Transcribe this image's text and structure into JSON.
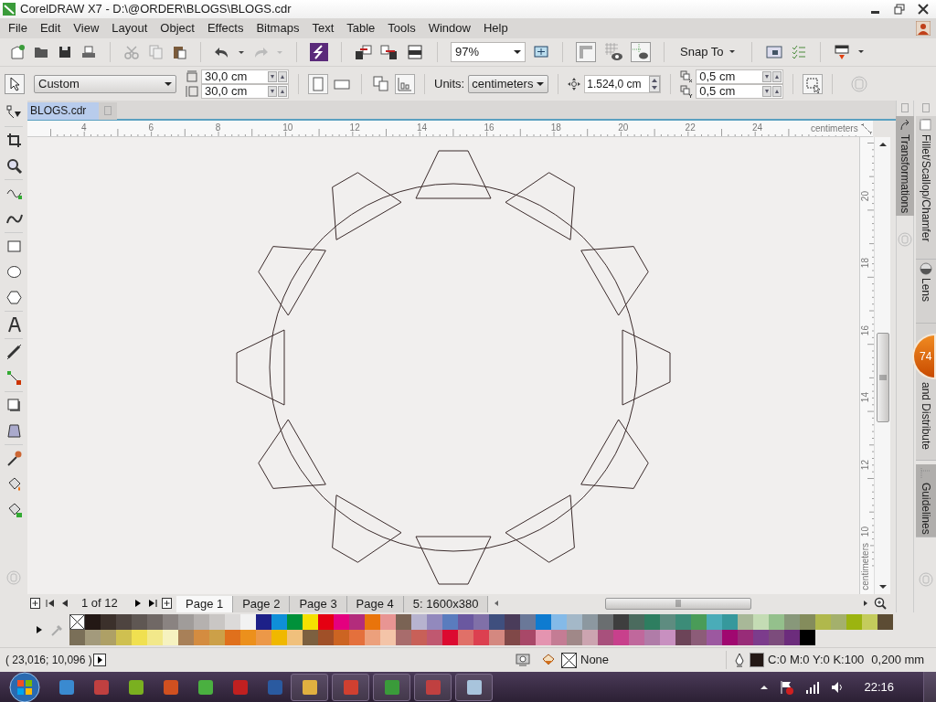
{
  "window": {
    "title": "CorelDRAW X7 - D:\\@ORDER\\BLOGS\\BLOGS.cdr"
  },
  "menu": [
    "File",
    "Edit",
    "View",
    "Layout",
    "Object",
    "Effects",
    "Bitmaps",
    "Text",
    "Table",
    "Tools",
    "Window",
    "Help"
  ],
  "toolbar": {
    "zoom": "97%",
    "snap_to": "Snap To"
  },
  "property_bar": {
    "page_size": "Custom",
    "width": "30,0 cm",
    "height": "30,0 cm",
    "units_label": "Units:",
    "units": "centimeters",
    "nudge": "1.524,0 cm",
    "dup_x": "0,5 cm",
    "dup_y": "0,5 cm"
  },
  "document_tab": {
    "title": "BLOGS.cdr"
  },
  "horizontal_ruler": {
    "ticks": [
      "4",
      "6",
      "8",
      "10",
      "12",
      "14",
      "16",
      "18",
      "20",
      "22",
      "24"
    ],
    "unit": "centimeters"
  },
  "vertical_ruler": {
    "ticks": [
      "20",
      "18",
      "16",
      "14",
      "12",
      "10"
    ],
    "unit": "centimeters"
  },
  "dockers": [
    {
      "label": "Transformations",
      "selected": true
    },
    {
      "label": "Fillet/Scallop/Chamfer",
      "selected": false
    },
    {
      "label": "Lens",
      "selected": false
    },
    {
      "label": "and Distribute",
      "selected": false
    },
    {
      "label": "Guidelines",
      "selected": true
    }
  ],
  "notification_badge": "74",
  "page_navigator": {
    "counter": "1 of 12",
    "pages": [
      {
        "label": "Page 1",
        "selected": true
      },
      {
        "label": "Page 2",
        "selected": false
      },
      {
        "label": "Page 3",
        "selected": false
      },
      {
        "label": "Page 4",
        "selected": false
      },
      {
        "label": "5: 1600x380",
        "selected": false
      }
    ]
  },
  "palette": {
    "rows": [
      [
        {
          "kind": "none"
        },
        {
          "kind": "swatch",
          "color": "#231815"
        },
        {
          "kind": "swatch",
          "color": "#3b302b"
        },
        {
          "kind": "swatch",
          "color": "#4e4440"
        },
        {
          "kind": "swatch",
          "color": "#5f5753"
        },
        {
          "kind": "swatch",
          "color": "#706865"
        },
        {
          "kind": "swatch",
          "color": "#8a8381"
        },
        {
          "kind": "swatch",
          "color": "#a09c9a"
        },
        {
          "kind": "swatch",
          "color": "#b5b1af"
        },
        {
          "kind": "swatch",
          "color": "#c9c6c4"
        },
        {
          "kind": "swatch",
          "color": "#dcdad9"
        },
        {
          "kind": "swatch",
          "color": "#f2f2f2"
        },
        {
          "kind": "swatch",
          "color": "#1d2088"
        },
        {
          "kind": "swatch",
          "color": "#0f8fd8"
        },
        {
          "kind": "swatch",
          "color": "#00913a"
        },
        {
          "kind": "swatch",
          "color": "#f5e100"
        },
        {
          "kind": "swatch",
          "color": "#e50012"
        },
        {
          "kind": "swatch",
          "color": "#e4007f"
        },
        {
          "kind": "swatch",
          "color": "#b32c7c"
        },
        {
          "kind": "swatch",
          "color": "#e9740b"
        },
        {
          "kind": "swatch",
          "color": "#e89593"
        },
        {
          "kind": "swatch",
          "color": "#7a6354"
        },
        {
          "kind": "swatch",
          "color": "#b7b3cf"
        },
        {
          "kind": "swatch",
          "color": "#9289bd"
        },
        {
          "kind": "swatch",
          "color": "#5a7cbe"
        },
        {
          "kind": "swatch",
          "color": "#6a58a0"
        },
        {
          "kind": "swatch",
          "color": "#8070a8"
        },
        {
          "kind": "swatch",
          "color": "#3f4f7e"
        },
        {
          "kind": "swatch",
          "color": "#4a3c5a"
        },
        {
          "kind": "swatch",
          "color": "#6a7898"
        },
        {
          "kind": "swatch",
          "color": "#0e7bd0"
        },
        {
          "kind": "swatch",
          "color": "#84bae8"
        },
        {
          "kind": "swatch",
          "color": "#a4b8c8"
        },
        {
          "kind": "swatch",
          "color": "#8c98a0"
        },
        {
          "kind": "swatch",
          "color": "#6a6e70"
        },
        {
          "kind": "swatch",
          "color": "#3e3e3e"
        },
        {
          "kind": "swatch",
          "color": "#4b6b5e"
        },
        {
          "kind": "swatch",
          "color": "#2e7e60"
        },
        {
          "kind": "swatch",
          "color": "#5e8c80"
        },
        {
          "kind": "swatch",
          "color": "#3c8c78"
        },
        {
          "kind": "swatch",
          "color": "#4a9c58"
        },
        {
          "kind": "swatch",
          "color": "#4aacb8"
        },
        {
          "kind": "swatch",
          "color": "#36989c"
        },
        {
          "kind": "swatch",
          "color": "#a8b898"
        },
        {
          "kind": "swatch",
          "color": "#c4dcb4"
        },
        {
          "kind": "swatch",
          "color": "#94c08c"
        },
        {
          "kind": "swatch",
          "color": "#88987a"
        },
        {
          "kind": "swatch",
          "color": "#848c5c"
        },
        {
          "kind": "swatch",
          "color": "#b0b84c"
        },
        {
          "kind": "swatch",
          "color": "#a4b06c"
        },
        {
          "kind": "swatch",
          "color": "#9cb410"
        },
        {
          "kind": "swatch",
          "color": "#c4cc5c"
        },
        {
          "kind": "swatch",
          "color": "#5c4c34"
        }
      ],
      [
        {
          "kind": "swatch",
          "color": "#7a6f58"
        },
        {
          "kind": "swatch",
          "color": "#a39a7c"
        },
        {
          "kind": "swatch",
          "color": "#aea066"
        },
        {
          "kind": "swatch",
          "color": "#cfc050"
        },
        {
          "kind": "swatch",
          "color": "#f0e050"
        },
        {
          "kind": "swatch",
          "color": "#f2e88a"
        },
        {
          "kind": "swatch",
          "color": "#f6f2c0"
        },
        {
          "kind": "swatch",
          "color": "#a88058"
        },
        {
          "kind": "swatch",
          "color": "#d48c40"
        },
        {
          "kind": "swatch",
          "color": "#cca048"
        },
        {
          "kind": "swatch",
          "color": "#e0701c"
        },
        {
          "kind": "swatch",
          "color": "#ec901c"
        },
        {
          "kind": "swatch",
          "color": "#ec9848"
        },
        {
          "kind": "swatch",
          "color": "#f0b800"
        },
        {
          "kind": "swatch",
          "color": "#f0c07c"
        },
        {
          "kind": "swatch",
          "color": "#7c6040"
        },
        {
          "kind": "swatch",
          "color": "#a05028"
        },
        {
          "kind": "swatch",
          "color": "#cc6422"
        },
        {
          "kind": "swatch",
          "color": "#e4703c"
        },
        {
          "kind": "swatch",
          "color": "#eca07c"
        },
        {
          "kind": "swatch",
          "color": "#f4c4a8"
        },
        {
          "kind": "swatch",
          "color": "#a86c6c"
        },
        {
          "kind": "swatch",
          "color": "#c86058"
        },
        {
          "kind": "swatch",
          "color": "#c05870"
        },
        {
          "kind": "swatch",
          "color": "#dc0a30"
        },
        {
          "kind": "swatch",
          "color": "#e07068"
        },
        {
          "kind": "swatch",
          "color": "#dc4050"
        },
        {
          "kind": "swatch",
          "color": "#d48880"
        },
        {
          "kind": "swatch",
          "color": "#804848"
        },
        {
          "kind": "swatch",
          "color": "#a84868"
        },
        {
          "kind": "swatch",
          "color": "#e494b0"
        },
        {
          "kind": "swatch",
          "color": "#c47c94"
        },
        {
          "kind": "swatch",
          "color": "#a08888"
        },
        {
          "kind": "swatch",
          "color": "#cca4b0"
        },
        {
          "kind": "swatch",
          "color": "#a8507c"
        },
        {
          "kind": "swatch",
          "color": "#c8408c"
        },
        {
          "kind": "swatch",
          "color": "#c0689c"
        },
        {
          "kind": "swatch",
          "color": "#b07ca8"
        },
        {
          "kind": "swatch",
          "color": "#c890c0"
        },
        {
          "kind": "swatch",
          "color": "#6c4458"
        },
        {
          "kind": "swatch",
          "color": "#8c5c78"
        },
        {
          "kind": "swatch",
          "color": "#9c58a0"
        },
        {
          "kind": "swatch",
          "color": "#a00870"
        },
        {
          "kind": "swatch",
          "color": "#982c78"
        },
        {
          "kind": "swatch",
          "color": "#7c3c8c"
        },
        {
          "kind": "swatch",
          "color": "#7c4c7c"
        },
        {
          "kind": "swatch",
          "color": "#6c2c7c"
        },
        {
          "kind": "swatch",
          "color": "#000000"
        }
      ]
    ]
  },
  "status_bar": {
    "coordinates": "( 23,016; 10,096 )",
    "fill": "None",
    "outline_color": "C:0 M:0 Y:0 K:100",
    "outline_width": "0,200 mm"
  },
  "taskbar": {
    "clock": "22:16"
  }
}
